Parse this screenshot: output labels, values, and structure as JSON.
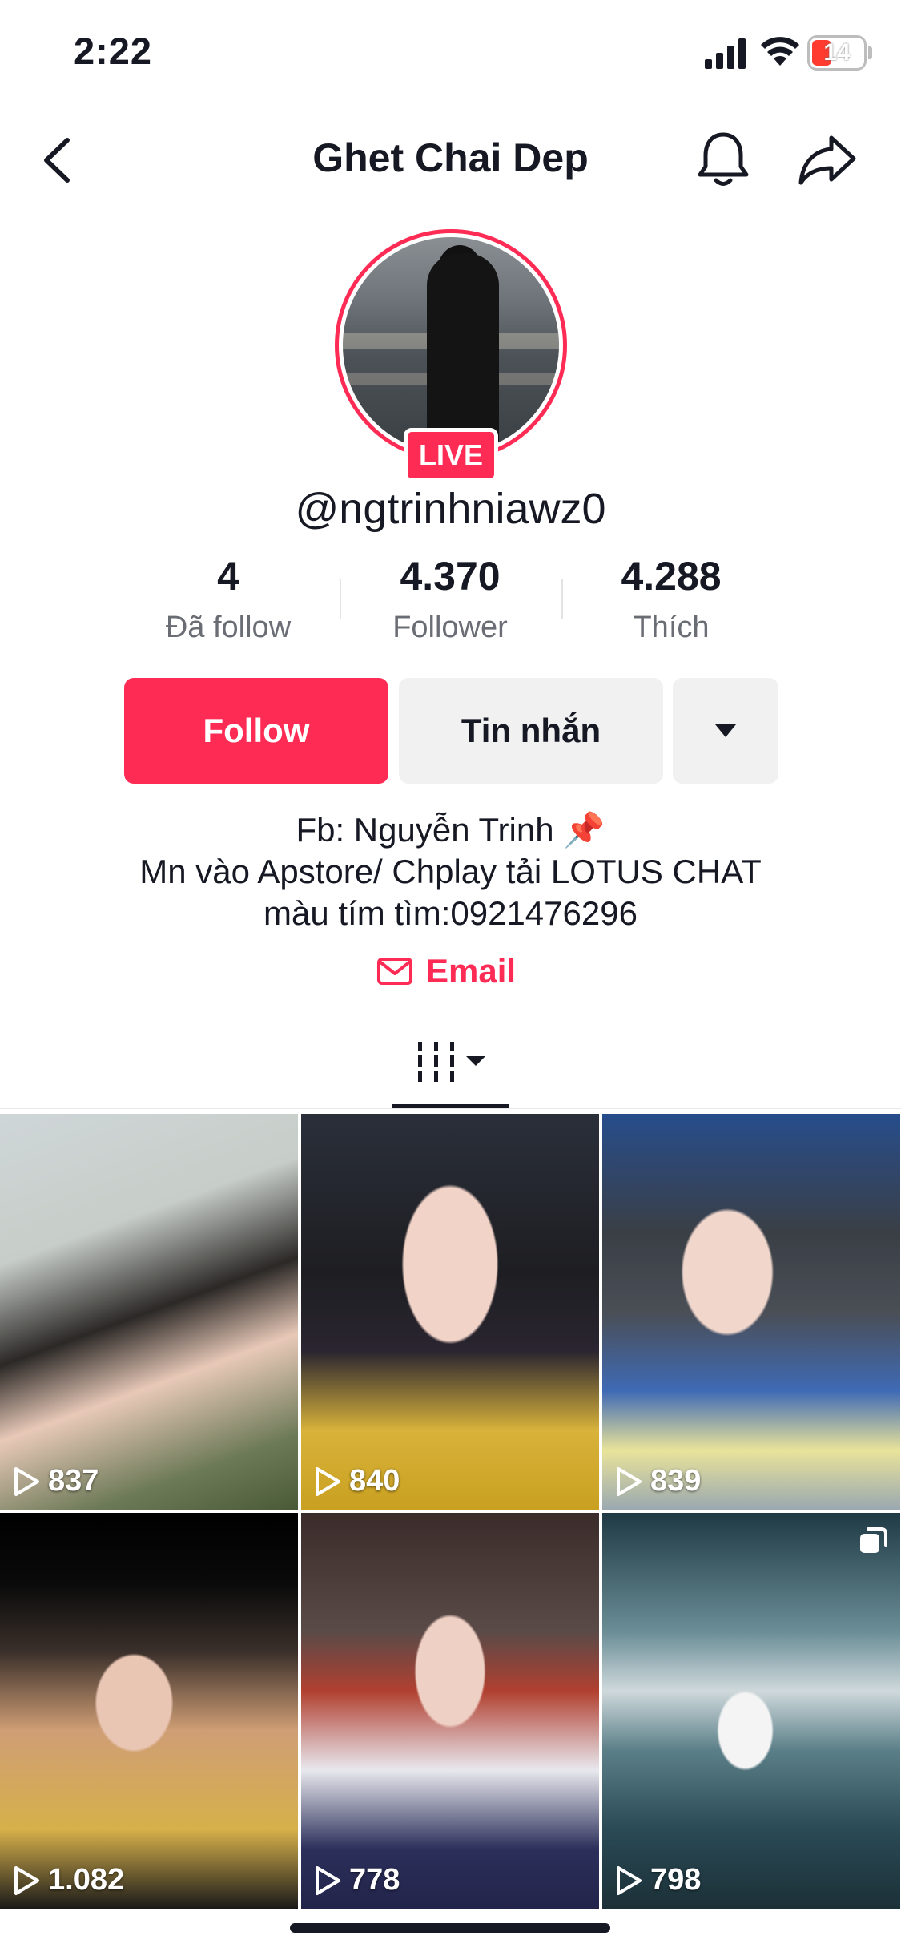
{
  "status_bar": {
    "time": "2:22",
    "battery": "14",
    "battery_color": "#ff3b30"
  },
  "header": {
    "title": "Ghet Chai Dep",
    "back_icon": "chevron-left-icon",
    "bell_icon": "bell-icon",
    "share_icon": "share-arrow-icon"
  },
  "profile": {
    "live_label": "LIVE",
    "username": "@ngtrinhniawz0",
    "stats": [
      {
        "value": "4",
        "label": "Đã follow"
      },
      {
        "value": "4.370",
        "label": "Follower"
      },
      {
        "value": "4.288",
        "label": "Thích"
      }
    ]
  },
  "actions": {
    "follow": "Follow",
    "message": "Tin nhắn"
  },
  "bio": {
    "line1": "Fb: Nguyễn Trinh 📌",
    "line2": "Mn vào Apstore/ Chplay tải LOTUS CHAT",
    "line3": "màu tím tìm:0921476296",
    "email_label": "Email"
  },
  "videos": [
    {
      "views": "837"
    },
    {
      "views": "840"
    },
    {
      "views": "839"
    },
    {
      "views": "1.082"
    },
    {
      "views": "778"
    },
    {
      "views": "798"
    }
  ],
  "colors": {
    "accent": "#fe2c55",
    "text": "#161823",
    "secondary_text": "#6b6d75",
    "button_bg": "#f1f1f2"
  }
}
